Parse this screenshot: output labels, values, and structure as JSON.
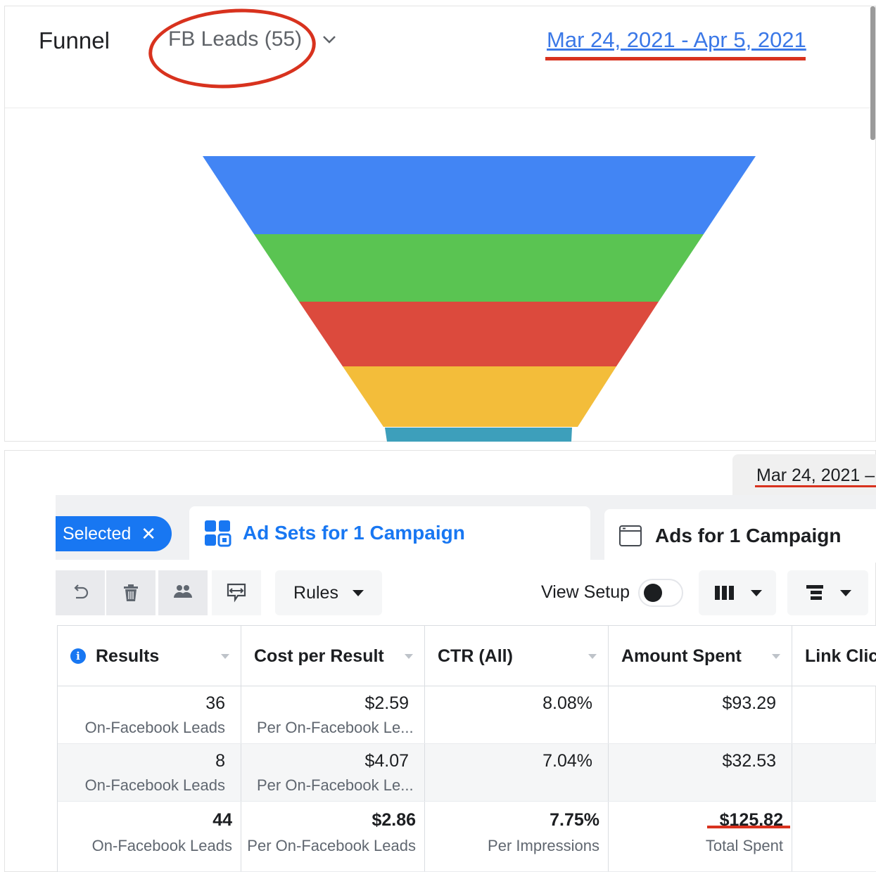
{
  "funnel": {
    "title": "Funnel",
    "dataset": "FB Leads (55)",
    "date_range": "Mar 24, 2021 - Apr 5, 2021",
    "stage_colors": [
      "#4285f4",
      "#5ac452",
      "#dc4a3d",
      "#f3bd3a",
      "#3d9fbb"
    ]
  },
  "ads": {
    "date_pill": "Mar 24, 2021 –",
    "selected_chip": "Selected",
    "tabs": {
      "adsets": "Ad Sets for 1 Campaign",
      "ads": "Ads for 1 Campaign"
    },
    "toolbar": {
      "rules": "Rules",
      "view_setup": "View Setup"
    },
    "columns": [
      "Results",
      "Cost per Result",
      "CTR (All)",
      "Amount Spent",
      "Link Click"
    ],
    "rows": [
      {
        "results": "36",
        "results_sub": "On-Facebook Leads",
        "cpr": "$2.59",
        "cpr_sub": "Per On-Facebook Le...",
        "ctr": "8.08%",
        "spent": "$93.29"
      },
      {
        "results": "8",
        "results_sub": "On-Facebook Leads",
        "cpr": "$4.07",
        "cpr_sub": "Per On-Facebook Le...",
        "ctr": "7.04%",
        "spent": "$32.53"
      }
    ],
    "total": {
      "results": "44",
      "results_sub": "On-Facebook Leads",
      "cpr": "$2.86",
      "cpr_sub": "Per On-Facebook Leads",
      "ctr": "7.75%",
      "ctr_sub": "Per Impressions",
      "spent": "$125.82",
      "spent_sub": "Total Spent"
    }
  }
}
